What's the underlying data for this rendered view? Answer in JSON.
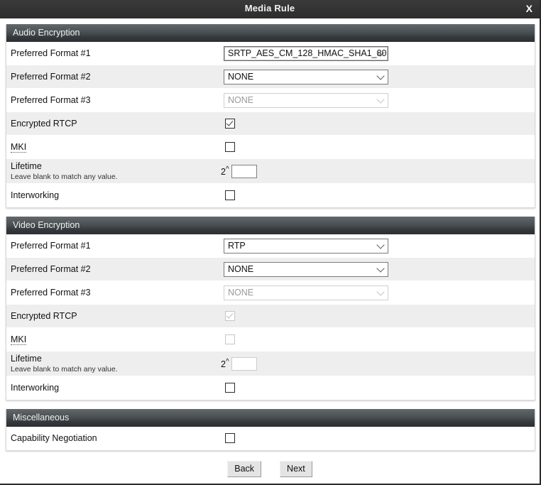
{
  "window": {
    "title": "Media Rule",
    "close_label": "X"
  },
  "sections": [
    {
      "name": "audio-encryption",
      "header": "Audio Encryption",
      "rows": [
        {
          "name": "audio-preferred-format-1",
          "label": "Preferred Format #1",
          "control": "select",
          "value": "SRTP_AES_CM_128_HMAC_SHA1_80",
          "disabled": false,
          "focused": true
        },
        {
          "name": "audio-preferred-format-2",
          "label": "Preferred Format #2",
          "control": "select",
          "value": "NONE",
          "disabled": false,
          "focused": false
        },
        {
          "name": "audio-preferred-format-3",
          "label": "Preferred Format #3",
          "control": "select",
          "value": "NONE",
          "disabled": true,
          "focused": false
        },
        {
          "name": "audio-encrypted-rtcp",
          "label": "Encrypted RTCP",
          "control": "checkbox",
          "checked": true,
          "disabled": false
        },
        {
          "name": "audio-mki",
          "label": "MKI",
          "control": "checkbox",
          "checked": false,
          "disabled": false,
          "hint": true
        },
        {
          "name": "audio-lifetime",
          "label": "Lifetime",
          "sublabel": "Leave blank to match any value.",
          "control": "lifetime",
          "prefix": "2",
          "exponent": "^",
          "value": "",
          "disabled": false
        },
        {
          "name": "audio-interworking",
          "label": "Interworking",
          "control": "checkbox",
          "checked": false,
          "disabled": false
        }
      ]
    },
    {
      "name": "video-encryption",
      "header": "Video Encryption",
      "rows": [
        {
          "name": "video-preferred-format-1",
          "label": "Preferred Format #1",
          "control": "select",
          "value": "RTP",
          "disabled": false,
          "focused": false
        },
        {
          "name": "video-preferred-format-2",
          "label": "Preferred Format #2",
          "control": "select",
          "value": "NONE",
          "disabled": false,
          "focused": false
        },
        {
          "name": "video-preferred-format-3",
          "label": "Preferred Format #3",
          "control": "select",
          "value": "NONE",
          "disabled": true,
          "focused": false
        },
        {
          "name": "video-encrypted-rtcp",
          "label": "Encrypted RTCP",
          "control": "checkbox",
          "checked": true,
          "disabled": true
        },
        {
          "name": "video-mki",
          "label": "MKI",
          "control": "checkbox",
          "checked": false,
          "disabled": true,
          "hint": true
        },
        {
          "name": "video-lifetime",
          "label": "Lifetime",
          "sublabel": "Leave blank to match any value.",
          "control": "lifetime",
          "prefix": "2",
          "exponent": "^",
          "value": "",
          "disabled": true
        },
        {
          "name": "video-interworking",
          "label": "Interworking",
          "control": "checkbox",
          "checked": false,
          "disabled": false
        }
      ]
    },
    {
      "name": "miscellaneous",
      "header": "Miscellaneous",
      "rows": [
        {
          "name": "capability-negotiation",
          "label": "Capability Negotiation",
          "control": "checkbox",
          "checked": false,
          "disabled": false
        }
      ]
    }
  ],
  "footer": {
    "back_label": "Back",
    "next_label": "Next"
  },
  "colors": {
    "titlebar_bg": "#2d2d2d",
    "section_header_dark": "#2c2f32",
    "section_header_light": "#63686c",
    "row_alt_bg": "#eeeeee",
    "button_bg": "#e4e4e4"
  }
}
